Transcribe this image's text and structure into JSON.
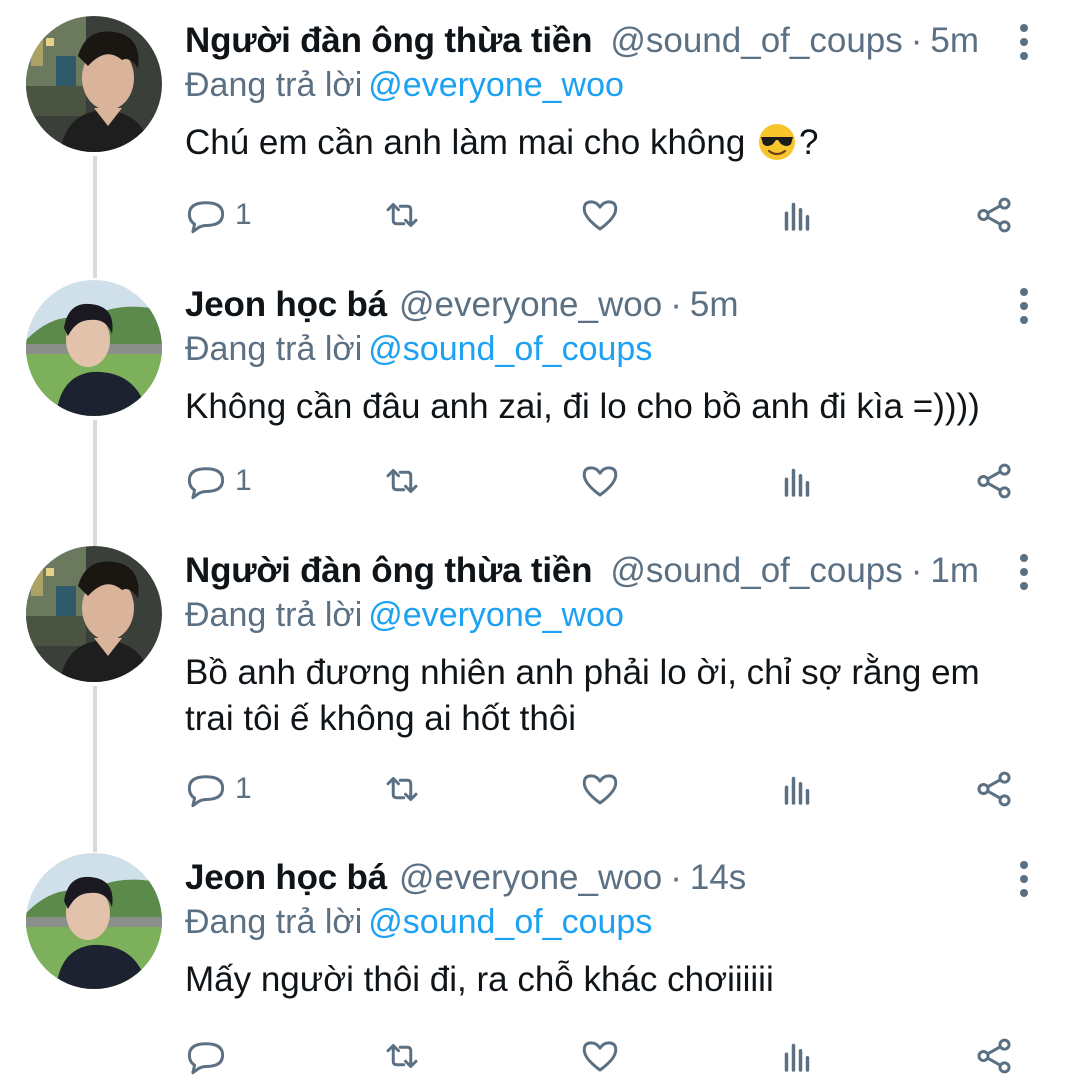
{
  "tweets": [
    {
      "name": "Người đàn ông thừa tiền",
      "handle": "@sound_of_coups",
      "sep": "·",
      "time": "5m",
      "replying_label": "Đang trả lời",
      "replying_to": "@everyone_woo",
      "text_before_emoji": "Chú em cần anh làm mai cho không ",
      "emoji": "smiling-face-with-sunglasses",
      "text_after_emoji": "?",
      "reply_count": "1",
      "avatar": "avatar-coups"
    },
    {
      "name": "Jeon học bá",
      "handle": "@everyone_woo",
      "sep": "·",
      "time": "5m",
      "replying_label": "Đang trả lời",
      "replying_to": "@sound_of_coups",
      "text": "Không cần đâu anh zai, đi lo cho bồ anh đi kìa =))))",
      "reply_count": "1",
      "avatar": "avatar-woo"
    },
    {
      "name": "Người đàn ông thừa tiền",
      "handle": "@sound_of_coups",
      "sep": "·",
      "time": "1m",
      "replying_label": "Đang trả lời",
      "replying_to": "@everyone_woo",
      "text": "Bồ anh đương nhiên anh phải lo ời, chỉ sợ rằng em trai tôi ế không ai hốt thôi",
      "reply_count": "1",
      "avatar": "avatar-coups"
    },
    {
      "name": "Jeon học bá",
      "handle": "@everyone_woo",
      "sep": "·",
      "time": "14s",
      "replying_label": "Đang trả lời",
      "replying_to": "@sound_of_coups",
      "text": "Mấy người thôi đi, ra chỗ khác chơiiiiii",
      "reply_count": "",
      "avatar": "avatar-woo"
    }
  ],
  "icons": {
    "reply": "reply-icon",
    "retweet": "retweet-icon",
    "like": "heart-icon",
    "analytics": "analytics-icon",
    "share": "share-icon",
    "more": "more-vertical-icon"
  },
  "colors": {
    "text": "#0f1419",
    "muted": "#5b7083",
    "mention": "#1da1f2",
    "thread_line": "#d6dbdf"
  }
}
